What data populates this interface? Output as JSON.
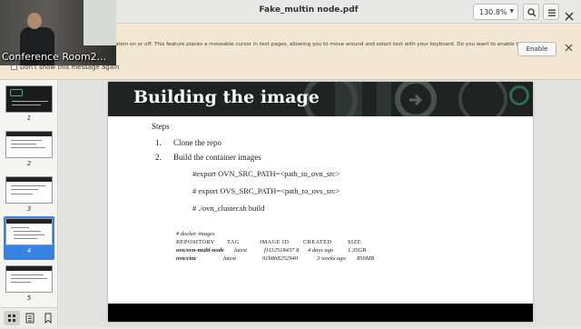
{
  "window": {
    "title": "Fake_multin node.pdf",
    "zoom_value": "130.8%"
  },
  "webcam": {
    "caption": "Conference Room2..."
  },
  "infobar": {
    "message": "ation on or off. This feature places a moveable cursor in text pages, allowing you to move around and select text with your keyboard. Do you want to enable the",
    "enable_label": "Enable",
    "dont_show_label": "Don't show this message again"
  },
  "sidebar": {
    "thumbnails": [
      {
        "number": "1"
      },
      {
        "number": "2"
      },
      {
        "number": "3"
      },
      {
        "number": "4"
      },
      {
        "number": "5"
      }
    ],
    "selected_index": 3
  },
  "slide": {
    "title": "Building the image",
    "steps_label": "Steps",
    "steps": [
      {
        "number": "1.",
        "text": "Clone the repo"
      },
      {
        "number": "2.",
        "text": "Build the container images"
      }
    ],
    "commands": [
      "#export OVN_SRC_PATH=<path_to_ovn_src>",
      "# export OVS_SRC_PATH=<path_to_ovs_src>",
      "# ./ovn_cluster.sh build"
    ],
    "docker": {
      "comment": "# docker images",
      "headers": [
        "REPOSITORY",
        "TAG",
        "IMAGE ID",
        "CREATED",
        "SIZE"
      ],
      "rows": [
        [
          "ovn/ovn-multi-node",
          "latest",
          "f1112518437 8",
          "4 days ago",
          "1.35GB"
        ],
        [
          "ovn/cinc",
          "latest",
          "91b8b8252940",
          "3 weeks ago",
          "856MB"
        ]
      ]
    }
  },
  "colors": {
    "accent": "#3584e4",
    "infobar_bg": "#f3e7d3",
    "banner_bg": "#1e2221"
  }
}
